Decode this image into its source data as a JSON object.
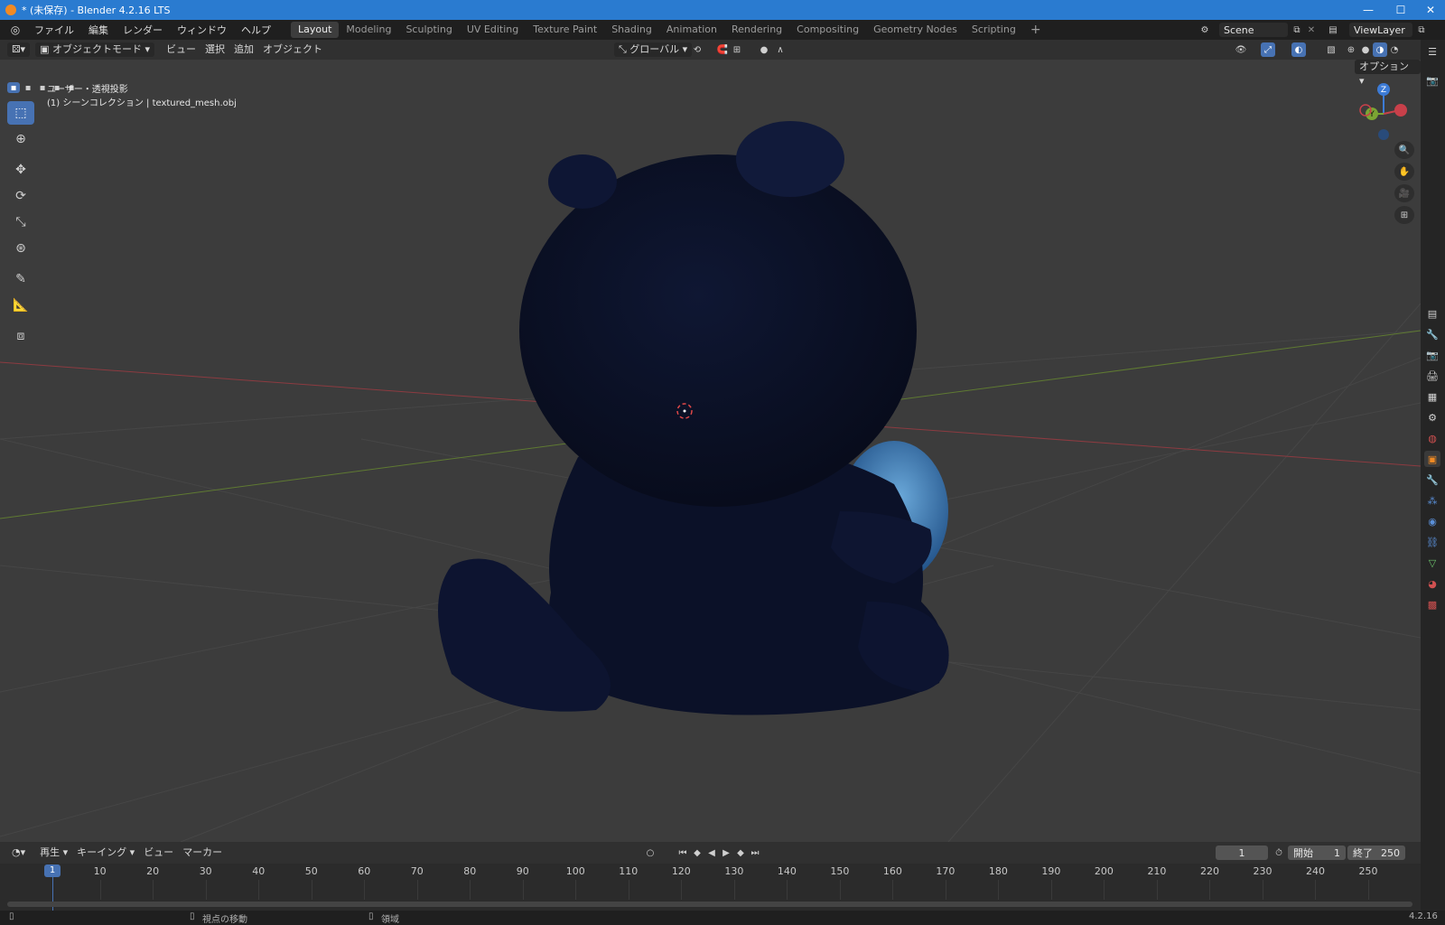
{
  "window": {
    "title": "* (未保存) - Blender 4.2.16 LTS",
    "minimize": "—",
    "maximize": "☐",
    "close": "✕"
  },
  "menu": {
    "items": [
      "ファイル",
      "編集",
      "レンダー",
      "ウィンドウ",
      "ヘルプ"
    ]
  },
  "workspaces": [
    {
      "label": "Layout",
      "active": true
    },
    {
      "label": "Modeling"
    },
    {
      "label": "Sculpting"
    },
    {
      "label": "UV Editing"
    },
    {
      "label": "Texture Paint"
    },
    {
      "label": "Shading"
    },
    {
      "label": "Animation"
    },
    {
      "label": "Rendering"
    },
    {
      "label": "Compositing"
    },
    {
      "label": "Geometry Nodes"
    },
    {
      "label": "Scripting"
    }
  ],
  "add_workspace": "+",
  "scene": {
    "name": "Scene",
    "view_layer": "ViewLayer"
  },
  "viewport_header": {
    "mode": "オブジェクトモード",
    "view": "ビュー",
    "select": "選択",
    "add": "追加",
    "object": "オブジェクト",
    "orientation": "グローバル",
    "options": "オプション"
  },
  "viewport": {
    "view_name": "ユーザー・透視投影",
    "collection_info": "(1) シーンコレクション | textured_mesh.obj",
    "gizmo": {
      "z": "Z",
      "y": "Y",
      "x": "X"
    }
  },
  "timeline": {
    "playback": "再生",
    "keying": "キーイング",
    "view": "ビュー",
    "marker": "マーカー",
    "current_frame": "1",
    "start_label": "開始",
    "start": "1",
    "end_label": "終了",
    "end": "250",
    "ticks": [
      "10",
      "20",
      "30",
      "40",
      "50",
      "60",
      "70",
      "80",
      "90",
      "100",
      "110",
      "120",
      "130",
      "140",
      "150",
      "160",
      "170",
      "180",
      "190",
      "200",
      "210",
      "220",
      "230",
      "240",
      "250"
    ],
    "current_frame_marker": "1"
  },
  "status": {
    "left_hint": "視点の移動",
    "right_hint": "領域",
    "version": "4.2.16"
  },
  "colors": {
    "accent": "#4772b3",
    "titlebar": "#2a7bd0",
    "axis_x": "#c8404a",
    "axis_y": "#7ba533",
    "axis_z": "#3c7bd6"
  }
}
